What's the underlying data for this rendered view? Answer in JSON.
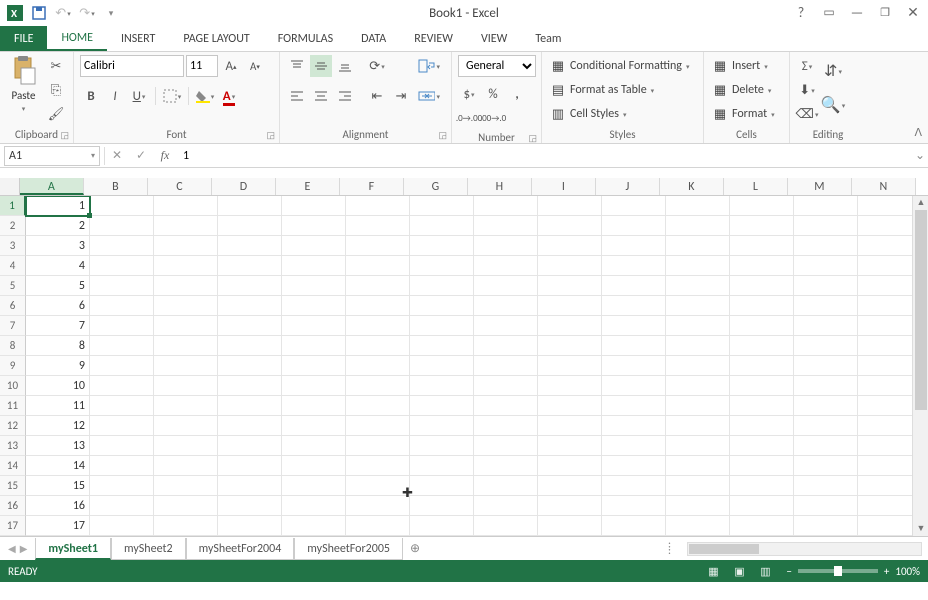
{
  "title": "Book1 - Excel",
  "qat": {
    "excel": "X▮",
    "save": "💾",
    "undo": "↶",
    "redo": "↷"
  },
  "tabs": [
    "FILE",
    "HOME",
    "INSERT",
    "PAGE LAYOUT",
    "FORMULAS",
    "DATA",
    "REVIEW",
    "VIEW",
    "Team"
  ],
  "active_tab": "HOME",
  "ribbon": {
    "clipboard": {
      "label": "Clipboard",
      "paste": "Paste"
    },
    "font": {
      "label": "Font",
      "name": "Calibri",
      "size": "11"
    },
    "alignment": {
      "label": "Alignment"
    },
    "number": {
      "label": "Number",
      "format": "General"
    },
    "styles": {
      "label": "Styles",
      "cond": "Conditional Formatting",
      "table": "Format as Table",
      "cell": "Cell Styles"
    },
    "cells": {
      "label": "Cells",
      "insert": "Insert",
      "delete": "Delete",
      "format": "Format"
    },
    "editing": {
      "label": "Editing"
    }
  },
  "namebox": "A1",
  "formula": "1",
  "columns": [
    "A",
    "B",
    "C",
    "D",
    "E",
    "F",
    "G",
    "H",
    "I",
    "J",
    "K",
    "L",
    "M",
    "N"
  ],
  "rows": [
    1,
    2,
    3,
    4,
    5,
    6,
    7,
    8,
    9,
    10,
    11,
    12,
    13,
    14,
    15,
    16,
    17
  ],
  "data_colA": [
    "1",
    "2",
    "3",
    "4",
    "5",
    "6",
    "7",
    "8",
    "9",
    "10",
    "11",
    "12",
    "13",
    "14",
    "15",
    "16",
    "17"
  ],
  "active_cell": "A1",
  "sheets": [
    "mySheet1",
    "mySheet2",
    "mySheetFor2004",
    "mySheetFor2005"
  ],
  "active_sheet": "mySheet1",
  "status": {
    "ready": "READY",
    "zoom": "100%"
  }
}
